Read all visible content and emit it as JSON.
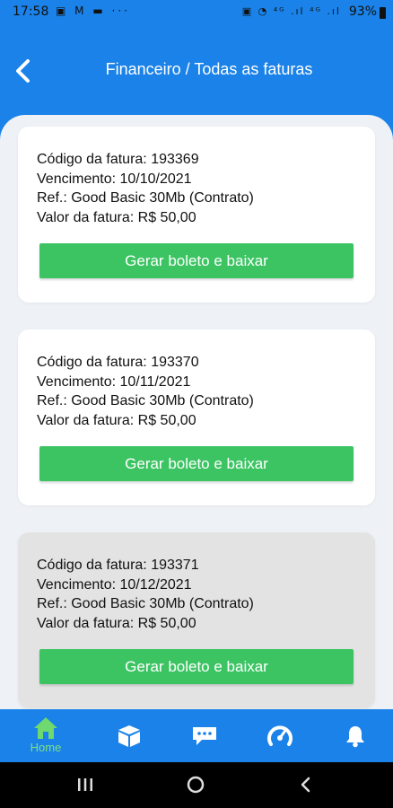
{
  "status_bar": {
    "time": "17:58",
    "battery": "93%",
    "left_icons": "▣ M ▬ ···",
    "right_icons": "▣ ◔ ⁴ᴳ .ıl ⁴ᴳ .ıl"
  },
  "header": {
    "title": "Financeiro / Todas as faturas"
  },
  "invoices": [
    {
      "code": "Código da fatura: 193369",
      "due": "Vencimento: 10/10/2021",
      "ref": "Ref.: Good Basic 30Mb (Contrato)",
      "amount": "Valor da fatura: R$ 50,00",
      "button": "Gerar boleto e baixar"
    },
    {
      "code": "Código da fatura: 193370",
      "due": "Vencimento: 10/11/2021",
      "ref": "Ref.: Good Basic 30Mb (Contrato)",
      "amount": "Valor da fatura: R$ 50,00",
      "button": "Gerar boleto e baixar"
    },
    {
      "code": "Código da fatura: 193371",
      "due": "Vencimento: 10/12/2021",
      "ref": "Ref.: Good Basic 30Mb (Contrato)",
      "amount": "Valor da fatura: R$ 50,00",
      "button": "Gerar boleto e baixar"
    }
  ],
  "bottom_nav": {
    "home_label": "Home",
    "items": [
      "home-icon",
      "box-icon",
      "chat-icon",
      "speedometer-icon",
      "bell-icon"
    ]
  },
  "colors": {
    "primary": "#1a82e8",
    "button": "#3cc463",
    "home_active": "#7fe07f"
  }
}
